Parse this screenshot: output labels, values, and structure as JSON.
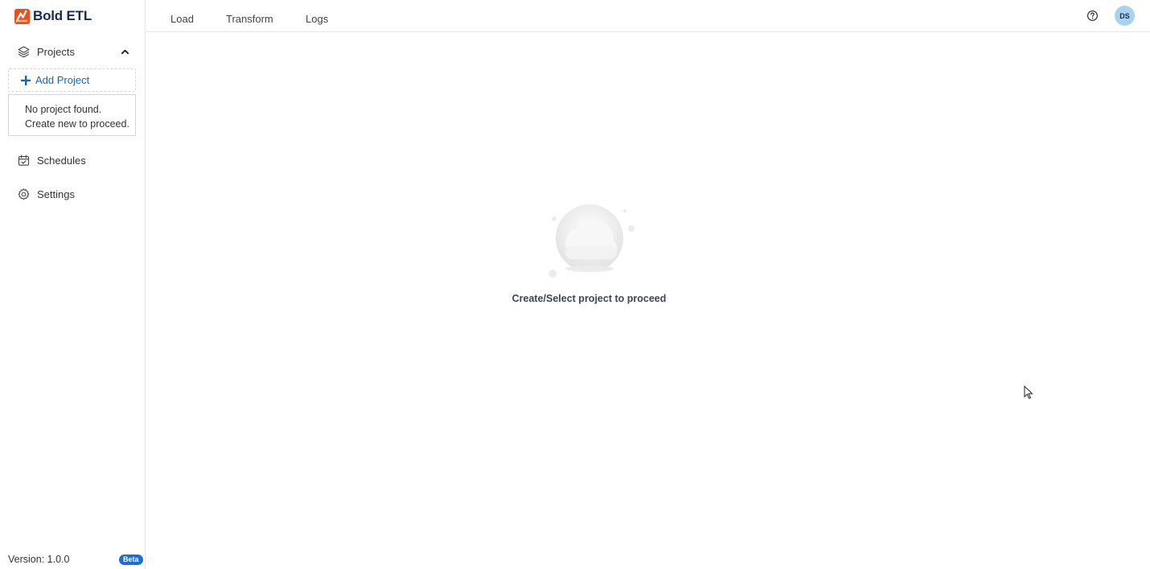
{
  "app": {
    "brand_name": "Bold ETL",
    "brand_color": "#e8531c"
  },
  "sidebar": {
    "projects_label": "Projects",
    "add_project_label": "Add Project",
    "empty_message": "No project found. Create new to proceed.",
    "items": [
      {
        "label": "Schedules",
        "icon": "calendar-check-icon"
      },
      {
        "label": "Settings",
        "icon": "gear-icon"
      }
    ],
    "version": "Version: 1.0.0",
    "badge": "Beta"
  },
  "topnav": {
    "tabs": [
      {
        "label": "Load"
      },
      {
        "label": "Transform"
      },
      {
        "label": "Logs"
      }
    ],
    "avatar_initials": "DS"
  },
  "main": {
    "empty_state_message": "Create/Select project to proceed"
  },
  "colors": {
    "accent": "#1565c0",
    "badge_bg": "#1a6fd1",
    "avatar_bg": "#a9d2f0"
  }
}
